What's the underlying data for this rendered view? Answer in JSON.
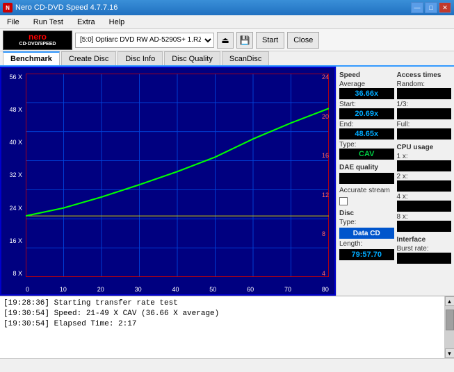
{
  "titlebar": {
    "title": "Nero CD-DVD Speed 4.7.7.16",
    "min_label": "—",
    "max_label": "□",
    "close_label": "✕"
  },
  "menubar": {
    "items": [
      "File",
      "Run Test",
      "Extra",
      "Help"
    ]
  },
  "toolbar": {
    "drive_value": "[5:0]  Optiarc DVD RW AD-5290S+ 1.RZ",
    "start_label": "Start",
    "close_label": "Close"
  },
  "tabs": {
    "items": [
      "Benchmark",
      "Create Disc",
      "Disc Info",
      "Disc Quality",
      "ScanDisc"
    ],
    "active": "Benchmark"
  },
  "chart": {
    "y_left_labels": [
      "56 X",
      "48 X",
      "40 X",
      "32 X",
      "24 X",
      "16 X",
      "8 X"
    ],
    "y_right_labels": [
      "24",
      "20",
      "16",
      "12",
      "8",
      "4"
    ],
    "x_labels": [
      "0",
      "10",
      "20",
      "30",
      "40",
      "50",
      "60",
      "70",
      "80"
    ]
  },
  "stats": {
    "speed": {
      "section": "Speed",
      "average_label": "Average",
      "average_value": "36.66x",
      "start_label": "Start:",
      "start_value": "20.69x",
      "end_label": "End:",
      "end_value": "48.65x",
      "type_label": "Type:",
      "type_value": "CAV"
    },
    "dae": {
      "section": "DAE quality",
      "value": "",
      "accurate_stream_label": "Accurate stream",
      "accurate_stream_checked": false
    },
    "disc": {
      "section": "Disc",
      "type_label": "Type:",
      "type_value": "Data CD",
      "length_label": "Length:",
      "length_value": "79:57.70"
    },
    "access": {
      "section": "Access times",
      "random_label": "Random:",
      "random_value": "",
      "one_third_label": "1/3:",
      "one_third_value": "",
      "full_label": "Full:",
      "full_value": ""
    },
    "cpu": {
      "section": "CPU usage",
      "x1_label": "1 x:",
      "x1_value": "",
      "x2_label": "2 x:",
      "x2_value": "",
      "x4_label": "4 x:",
      "x4_value": "",
      "x8_label": "8 x:",
      "x8_value": ""
    },
    "interface": {
      "section": "Interface",
      "burst_label": "Burst rate:",
      "burst_value": ""
    }
  },
  "log": {
    "lines": [
      "[19:28:36]  Starting transfer rate test",
      "[19:30:54]  Speed: 21-49 X CAV (36.66 X average)",
      "[19:30:54]  Elapsed Time: 2:17"
    ]
  },
  "statusbar": {
    "text": ""
  }
}
